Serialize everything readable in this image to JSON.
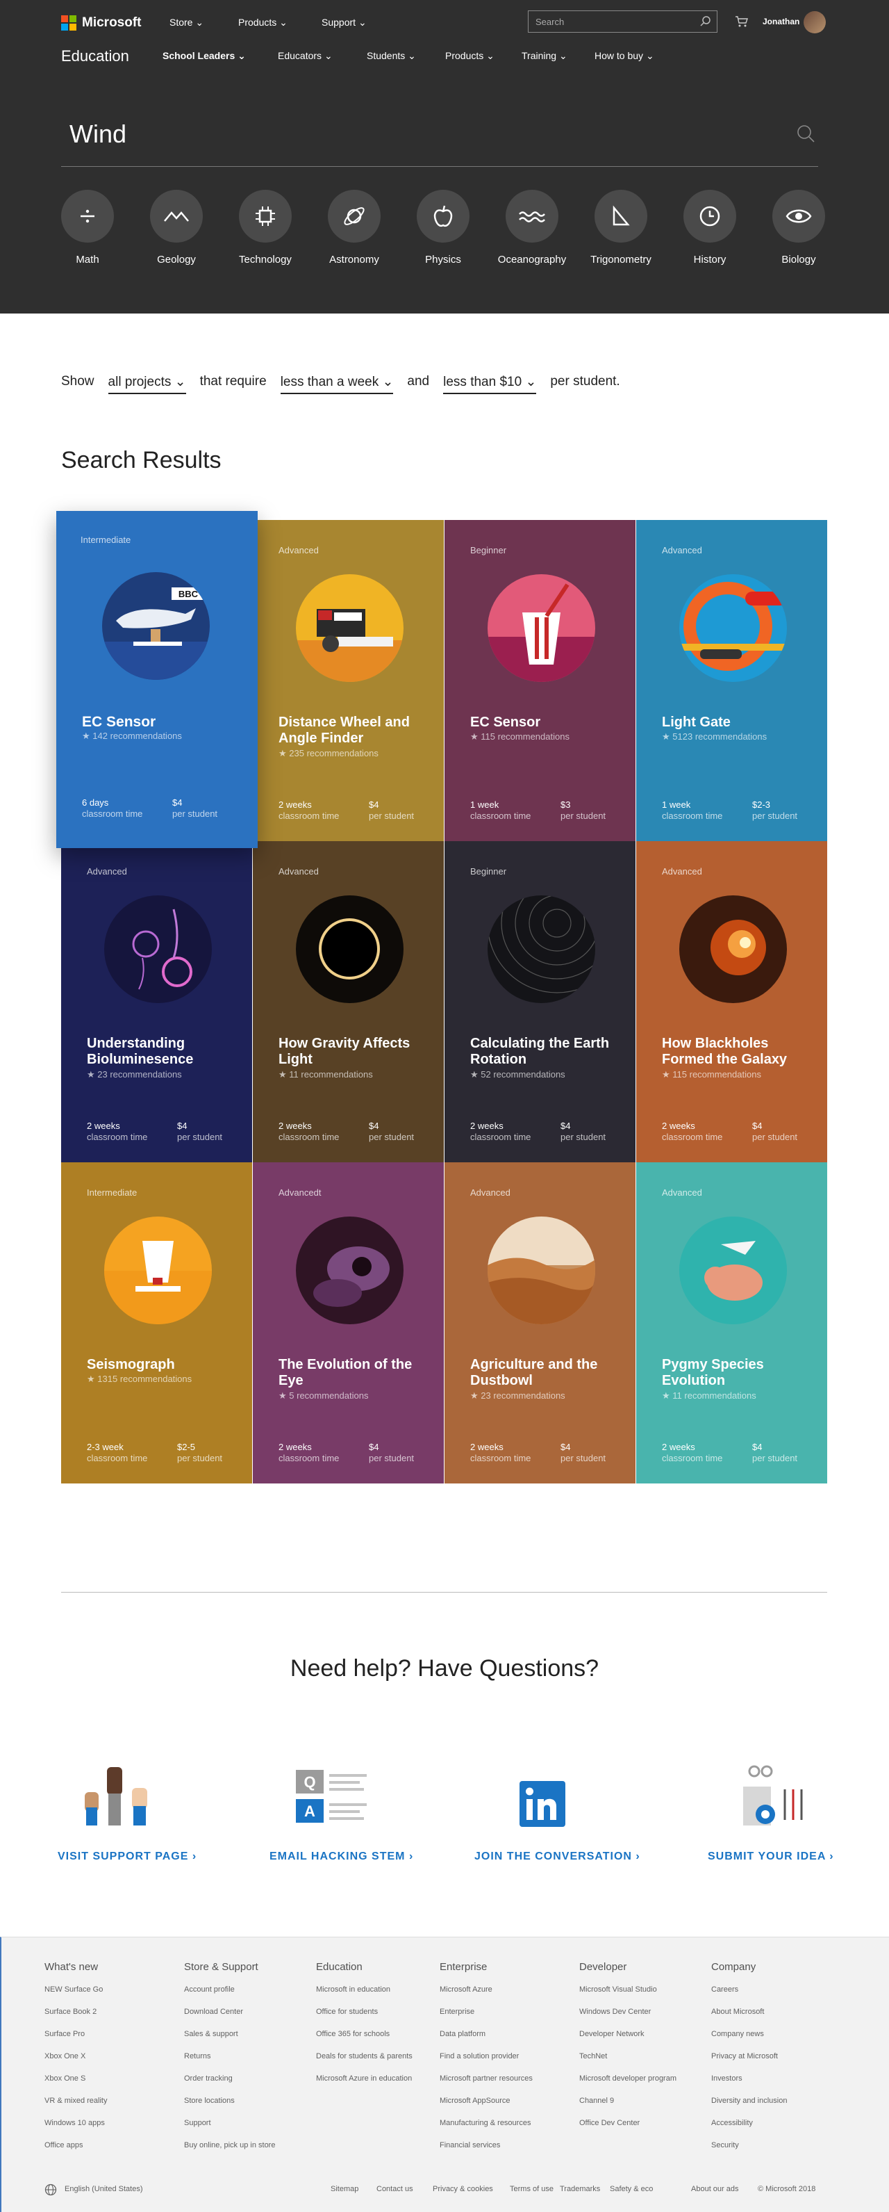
{
  "nav": {
    "brand": "Microsoft",
    "items": [
      "Store",
      "Products",
      "Support"
    ],
    "search_placeholder": "Search",
    "user": "Jonathan"
  },
  "subnav": {
    "title": "Education",
    "items": [
      "School Leaders",
      "Educators",
      "Students",
      "Products",
      "Training",
      "How to buy"
    ]
  },
  "search": {
    "query": "Wind"
  },
  "categories": [
    {
      "label": "Math",
      "icon": "divide-icon"
    },
    {
      "label": "Geology",
      "icon": "mountain-icon"
    },
    {
      "label": "Technology",
      "icon": "chip-icon"
    },
    {
      "label": "Astronomy",
      "icon": "planet-icon"
    },
    {
      "label": "Physics",
      "icon": "apple-icon"
    },
    {
      "label": "Oceanography",
      "icon": "wave-icon"
    },
    {
      "label": "Trigonometry",
      "icon": "triangle-icon"
    },
    {
      "label": "History",
      "icon": "clock-icon"
    },
    {
      "label": "Biology",
      "icon": "eye-icon"
    }
  ],
  "filter": {
    "show": "Show",
    "projects": "all projects",
    "require": "that require",
    "time": "less than a week",
    "and": "and",
    "cost": "less than $10",
    "per": "per student."
  },
  "results_title": "Search Results",
  "cards": [
    {
      "level": "Intermediate",
      "title": "EC Sensor",
      "recs": "142 recommendations",
      "time": "6 days",
      "cost": "$4",
      "color": "#2b72c0",
      "art": "#1e3d7a"
    },
    {
      "level": "Advanced",
      "title": "Distance Wheel and Angle Finder",
      "recs": "235 recommendations",
      "time": "2 weeks",
      "cost": "$4",
      "color": "#a88630",
      "art": "#f0b425"
    },
    {
      "level": "Beginner",
      "title": "EC Sensor",
      "recs": "115 recommendations",
      "time": "1 week",
      "cost": "$3",
      "color": "#6e3450",
      "art": "#e25a79"
    },
    {
      "level": "Advanced",
      "title": "Light Gate",
      "recs": "5123 recommendations",
      "time": "1 week",
      "cost": "$2-3",
      "color": "#2a88b4",
      "art": "#1e9ad4"
    },
    {
      "level": "Advanced",
      "title": "Understanding Bioluminesence",
      "recs": "23 recommendations",
      "time": "2 weeks",
      "cost": "$4",
      "color": "#1d2157",
      "art": "#15153d"
    },
    {
      "level": "Advanced",
      "title": "How Gravity Affects Light",
      "recs": "11 recommendations",
      "time": "2 weeks",
      "cost": "$4",
      "color": "#584125",
      "art": "#0e0b08"
    },
    {
      "level": "Beginner",
      "title": "Calculating the Earth Rotation",
      "recs": "52 recommendations",
      "time": "2 weeks",
      "cost": "$4",
      "color": "#2b2933",
      "art": "#141418"
    },
    {
      "level": "Advanced",
      "title": "How Blackholes Formed the Galaxy",
      "recs": "115 recommendations",
      "time": "2 weeks",
      "cost": "$4",
      "color": "#b55f30",
      "art": "#3a1a0d"
    },
    {
      "level": "Intermediate",
      "title": "Seismograph",
      "recs": "1315 recommendations",
      "time": "2-3 week",
      "cost": "$2-5",
      "color": "#ae7f24",
      "art": "#f5a321"
    },
    {
      "level": "Advancedt",
      "title": "The Evolution of the Eye",
      "recs": "5 recommendations",
      "time": "2 weeks",
      "cost": "$4",
      "color": "#783b67",
      "art": "#2f1424"
    },
    {
      "level": "Advanced",
      "title": "Agriculture and the Dustbowl",
      "recs": "23 recommendations",
      "time": "2 weeks",
      "cost": "$4",
      "color": "#aa673a",
      "art": "#c7915f"
    },
    {
      "level": "Advanced",
      "title": "Pygmy Species Evolution",
      "recs": "11 recommendations",
      "time": "2 weeks",
      "cost": "$4",
      "color": "#49b4ad",
      "art": "#3ab5b0"
    }
  ],
  "labels": {
    "classroom": "classroom time",
    "per_student": "per student"
  },
  "help": {
    "title": "Need help? Have Questions?",
    "links": [
      "VISIT SUPPORT PAGE",
      "EMAIL HACKING STEM",
      "JOIN THE CONVERSATION",
      "SUBMIT YOUR IDEA"
    ]
  },
  "footer": {
    "cols": [
      {
        "head": "What's new",
        "items": [
          "NEW Surface Go",
          "Surface Book 2",
          "Surface Pro",
          "Xbox One X",
          "Xbox One S",
          "VR & mixed reality",
          "Windows 10 apps",
          "Office apps"
        ]
      },
      {
        "head": "Store & Support",
        "items": [
          "Account profile",
          "Download Center",
          "Sales & support",
          "Returns",
          "Order tracking",
          "Store locations",
          "Support",
          "Buy online, pick up in store"
        ]
      },
      {
        "head": "Education",
        "items": [
          "Microsoft in education",
          "Office for students",
          "Office 365 for schools",
          "Deals for students & parents",
          "Microsoft Azure in education"
        ]
      },
      {
        "head": "Enterprise",
        "items": [
          "Microsoft Azure",
          "Enterprise",
          "Data platform",
          "Find a solution provider",
          "Microsoft partner resources",
          "Microsoft AppSource",
          "Manufacturing & resources",
          "Financial services"
        ]
      },
      {
        "head": "Developer",
        "items": [
          "Microsoft Visual Studio",
          "Windows Dev Center",
          "Developer Network",
          "TechNet",
          "Microsoft developer program",
          "Channel 9",
          "Office Dev Center"
        ]
      },
      {
        "head": "Company",
        "items": [
          "Careers",
          "About Microsoft",
          "Company news",
          "Privacy at Microsoft",
          "Investors",
          "Diversity and inclusion",
          "Accessibility",
          "Security"
        ]
      }
    ],
    "locale": "English (United States)",
    "bottom": [
      "Sitemap",
      "Contact us",
      "Privacy & cookies",
      "Terms of use",
      "Trademarks",
      "Safety & eco",
      "About our ads",
      "© Microsoft 2018"
    ]
  }
}
